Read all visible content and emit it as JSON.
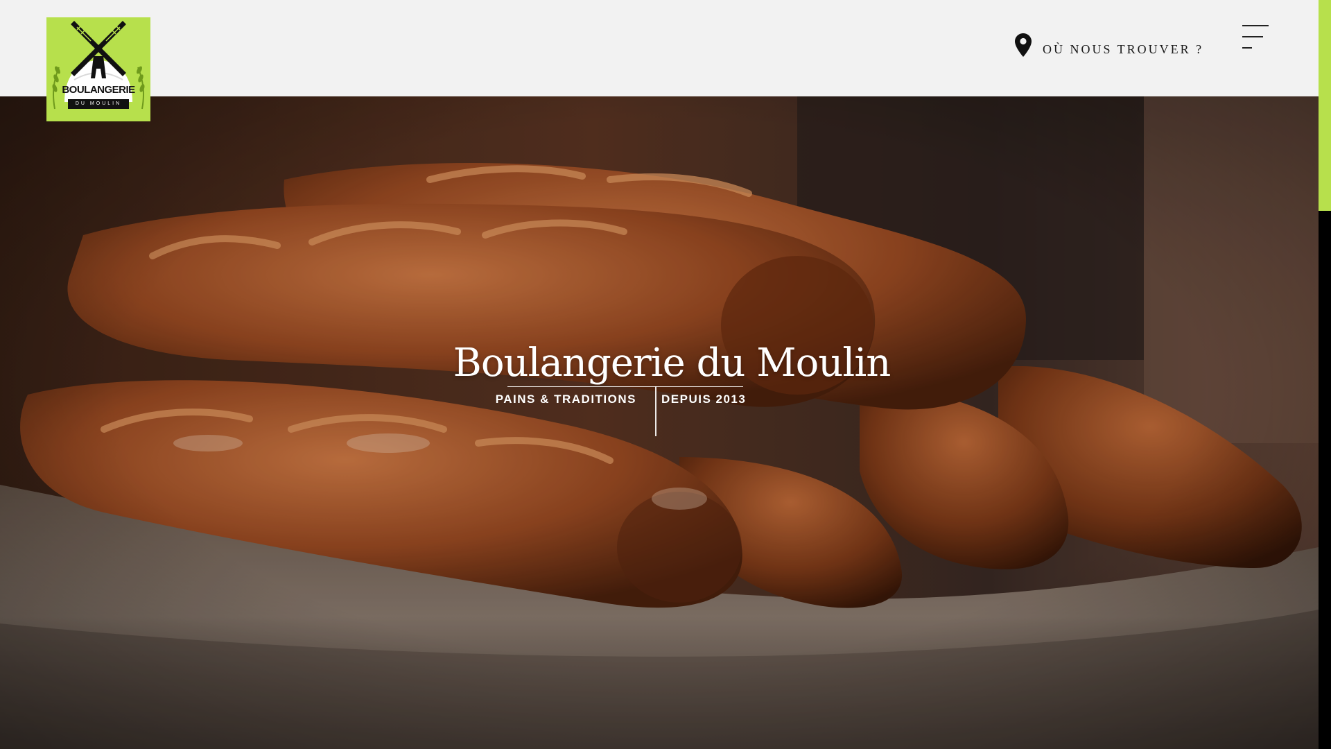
{
  "brand": {
    "logo_word": "BOULANGERIE",
    "logo_sub": "DU MOULIN",
    "accent_color": "#b7e04c"
  },
  "header": {
    "locate_label": "OÙ NOUS TROUVER ?",
    "locate_icon": "map-pin-icon",
    "menu_icon": "hamburger-menu-icon"
  },
  "hero": {
    "title": "Boulangerie du Moulin",
    "tag_left": "PAINS & TRADITIONS",
    "tag_right": "DEPUIS 2013"
  },
  "scrollbar": {
    "thumb_color": "#b7e04c",
    "track_color": "#000000"
  }
}
